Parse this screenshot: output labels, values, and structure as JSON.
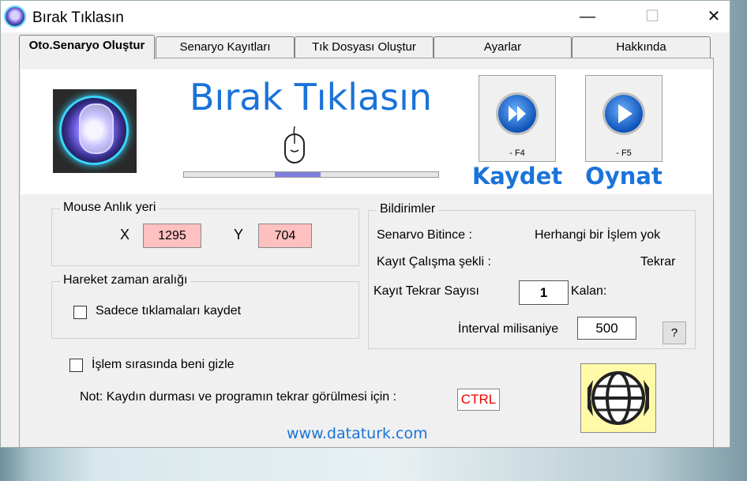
{
  "window": {
    "title": "Bırak Tıklasın",
    "minimize": "—",
    "maximize": "☐",
    "close": "✕"
  },
  "tabs": [
    {
      "label": "Oto.Senaryo Oluştur",
      "active": true
    },
    {
      "label": "Senaryo Kayıtları"
    },
    {
      "label": "Tık Dosyası Oluştur"
    },
    {
      "label": "Ayarlar"
    },
    {
      "label": "Hakkında"
    }
  ],
  "banner": {
    "title": "Bırak Tıklasın",
    "record": {
      "hint": "- F4",
      "caption": "Kaydet"
    },
    "play": {
      "hint": "- F5",
      "caption": "Oynat"
    },
    "progress": 0.18
  },
  "mouse_pos": {
    "title": "Mouse Anlık yeri",
    "x_label": "X",
    "x_value": "1295",
    "y_label": "Y",
    "y_value": "704"
  },
  "move_interval": {
    "title": "Hareket zaman aralığı",
    "clicks_only_label": "Sadece tıklamaları kaydet"
  },
  "hide_label": "İşlem sırasında beni gizle",
  "note": {
    "text": "Not: Kaydın durması ve programın tekrar görülmesi için :",
    "key": "CTRL"
  },
  "website": "www.dataturk.com",
  "notifications": {
    "title": "Bildirimler",
    "scenario_end_label": "Senarvo Bitince :",
    "scenario_end_value": "Herhangi bir İşlem yok",
    "mode_label": "Kayıt Çalışma şekli :",
    "mode_value": "Tekrar",
    "repeat_label": "Kayıt Tekrar Sayısı",
    "repeat_value": "1",
    "remaining_label": "Kalan:",
    "interval_label": "İnterval milisaniye",
    "interval_value": "500",
    "help": "?"
  },
  "colors": {
    "accent": "#1a73d9",
    "coord_bg": "#ffc0c0",
    "ctrl_text": "#e00000"
  }
}
